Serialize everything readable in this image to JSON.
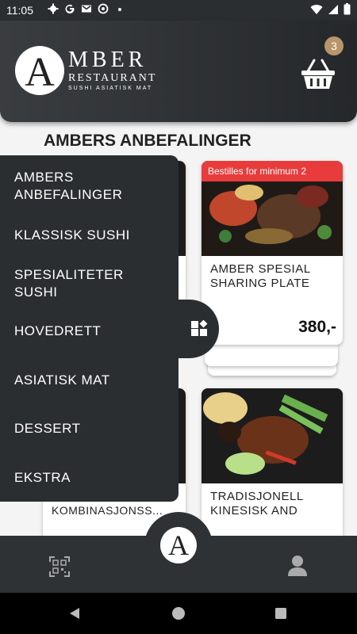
{
  "status": {
    "time": "11:05"
  },
  "header": {
    "logo_letter": "A",
    "brand": "MBER",
    "sub": "RESTAURANT",
    "tagline": "SUSHI ASIATISK MAT",
    "cart_count": "3"
  },
  "section": {
    "title": "AMBERS ANBEFALINGER"
  },
  "cards": [
    {
      "badge": "Bestilles for minimum 2",
      "name_line1": "AMBER SPESIAL",
      "name_line2": "SHARING PLATE",
      "price": "380,-"
    },
    {
      "name_line1": "KOMBINASJONSS..."
    },
    {
      "name_line1": "TRADISJONELL",
      "name_line2": "KINESISK AND"
    }
  ],
  "menu": {
    "items": [
      {
        "line1": "AMBERS",
        "line2": "ANBEFALINGER"
      },
      {
        "line1": "KLASSISK SUSHI"
      },
      {
        "line1": "SPESIALITETER",
        "line2": "SUSHI"
      },
      {
        "line1": "HOVEDRETT"
      },
      {
        "line1": "ASIATISK MAT"
      },
      {
        "line1": "DESSERT"
      },
      {
        "line1": "EKSTRA"
      }
    ]
  },
  "bottomnav": {
    "center_letter": "A"
  }
}
